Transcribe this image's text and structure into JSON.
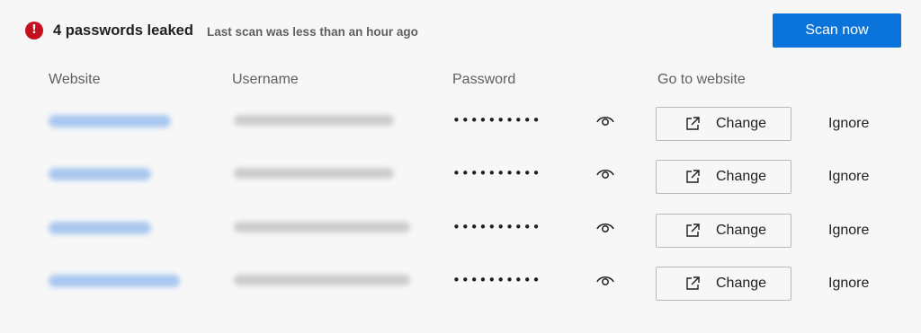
{
  "header": {
    "title": "4 passwords leaked",
    "alert_icon": "!",
    "alert_color": "#c50f1f",
    "subtitle": "Last scan was less than an hour ago",
    "scan_button_label": "Scan now",
    "accent_color": "#0a74da"
  },
  "columns": {
    "website": "Website",
    "username": "Username",
    "password": "Password",
    "go_to_website": "Go to website"
  },
  "rows": [
    {
      "website_blurred": true,
      "username_blurred": true,
      "password": "••••••••••",
      "reveal_icon": "eye-icon",
      "change_label": "Change",
      "change_icon": "external-link-icon",
      "ignore_label": "Ignore"
    },
    {
      "website_blurred": true,
      "username_blurred": true,
      "password": "••••••••••",
      "reveal_icon": "eye-icon",
      "change_label": "Change",
      "change_icon": "external-link-icon",
      "ignore_label": "Ignore"
    },
    {
      "website_blurred": true,
      "username_blurred": true,
      "password": "••••••••••",
      "reveal_icon": "eye-icon",
      "change_label": "Change",
      "change_icon": "external-link-icon",
      "ignore_label": "Ignore"
    },
    {
      "website_blurred": true,
      "username_blurred": true,
      "password": "••••••••••",
      "reveal_icon": "eye-icon",
      "change_label": "Change",
      "change_icon": "external-link-icon",
      "ignore_label": "Ignore"
    }
  ]
}
